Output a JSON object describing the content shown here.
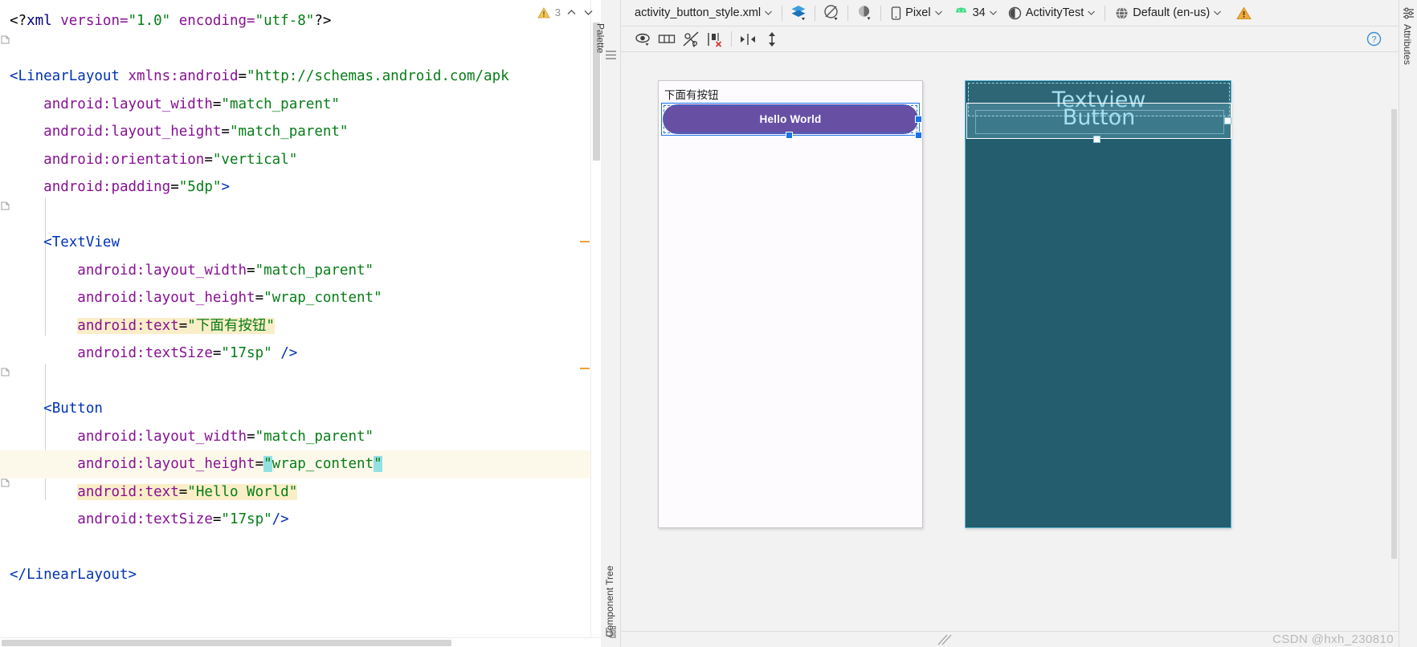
{
  "editor": {
    "inspection_count": "3",
    "lines": [
      {
        "id": "l1",
        "current": false,
        "tokens": [
          {
            "t": "<?",
            "c": "punct"
          },
          {
            "t": "xml",
            "c": "proc"
          },
          {
            "t": " version=",
            "c": "attr"
          },
          {
            "t": "\"1.0\"",
            "c": "val"
          },
          {
            "t": " encoding=",
            "c": "attr"
          },
          {
            "t": "\"utf-8\"",
            "c": "val"
          },
          {
            "t": "?>",
            "c": "punct"
          }
        ]
      },
      {
        "id": "l2",
        "current": false,
        "tokens": []
      },
      {
        "id": "l3",
        "current": false,
        "tokens": [
          {
            "t": "<LinearLayout",
            "c": "tag"
          },
          {
            "t": " xmlns:",
            "c": "ns"
          },
          {
            "t": "android",
            "c": "ns"
          },
          {
            "t": "=",
            "c": "punct"
          },
          {
            "t": "\"http://schemas.android.com/apk",
            "c": "val"
          }
        ]
      },
      {
        "id": "l4",
        "current": false,
        "tokens": [
          {
            "t": "    ",
            "c": "punct"
          },
          {
            "t": "android:layout_width",
            "c": "attr"
          },
          {
            "t": "=",
            "c": "punct"
          },
          {
            "t": "\"match_parent\"",
            "c": "val"
          }
        ]
      },
      {
        "id": "l5",
        "current": false,
        "tokens": [
          {
            "t": "    ",
            "c": "punct"
          },
          {
            "t": "android:layout_height",
            "c": "attr"
          },
          {
            "t": "=",
            "c": "punct"
          },
          {
            "t": "\"match_parent\"",
            "c": "val"
          }
        ]
      },
      {
        "id": "l6",
        "current": false,
        "tokens": [
          {
            "t": "    ",
            "c": "punct"
          },
          {
            "t": "android:orientation",
            "c": "attr"
          },
          {
            "t": "=",
            "c": "punct"
          },
          {
            "t": "\"vertical\"",
            "c": "val"
          }
        ]
      },
      {
        "id": "l7",
        "current": false,
        "tokens": [
          {
            "t": "    ",
            "c": "punct"
          },
          {
            "t": "android:padding",
            "c": "attr"
          },
          {
            "t": "=",
            "c": "punct"
          },
          {
            "t": "\"5dp\"",
            "c": "val"
          },
          {
            "t": ">",
            "c": "tag"
          }
        ]
      },
      {
        "id": "l8",
        "current": false,
        "tokens": []
      },
      {
        "id": "l9",
        "current": false,
        "tokens": [
          {
            "t": "    ",
            "c": "punct"
          },
          {
            "t": "<TextView",
            "c": "tag"
          }
        ]
      },
      {
        "id": "l10",
        "current": false,
        "tokens": [
          {
            "t": "        ",
            "c": "punct"
          },
          {
            "t": "android:layout_width",
            "c": "attr"
          },
          {
            "t": "=",
            "c": "punct"
          },
          {
            "t": "\"match_parent\"",
            "c": "val"
          }
        ]
      },
      {
        "id": "l11",
        "current": false,
        "tokens": [
          {
            "t": "        ",
            "c": "punct"
          },
          {
            "t": "android:layout_height",
            "c": "attr"
          },
          {
            "t": "=",
            "c": "punct"
          },
          {
            "t": "\"wrap_content\"",
            "c": "val"
          }
        ]
      },
      {
        "id": "l12",
        "current": false,
        "tokens": [
          {
            "t": "        ",
            "c": "punct"
          },
          {
            "t": "android:text",
            "c": "attr",
            "h": "y"
          },
          {
            "t": "=",
            "c": "punct",
            "h": "y"
          },
          {
            "t": "\"下面有按钮\"",
            "c": "val",
            "h": "y"
          }
        ]
      },
      {
        "id": "l13",
        "current": false,
        "tokens": [
          {
            "t": "        ",
            "c": "punct"
          },
          {
            "t": "android:textSize",
            "c": "attr"
          },
          {
            "t": "=",
            "c": "punct"
          },
          {
            "t": "\"17sp\"",
            "c": "val"
          },
          {
            "t": " ",
            "c": "punct"
          },
          {
            "t": "/>",
            "c": "tag"
          }
        ]
      },
      {
        "id": "l14",
        "current": false,
        "tokens": []
      },
      {
        "id": "l15",
        "current": false,
        "tokens": [
          {
            "t": "    ",
            "c": "punct"
          },
          {
            "t": "<Button",
            "c": "tag"
          }
        ]
      },
      {
        "id": "l16",
        "current": false,
        "tokens": [
          {
            "t": "        ",
            "c": "punct"
          },
          {
            "t": "android:layout_width",
            "c": "attr"
          },
          {
            "t": "=",
            "c": "punct"
          },
          {
            "t": "\"match_parent\"",
            "c": "val"
          }
        ]
      },
      {
        "id": "l17",
        "current": true,
        "tokens": [
          {
            "t": "        ",
            "c": "punct"
          },
          {
            "t": "android:layout_height",
            "c": "attr"
          },
          {
            "t": "=",
            "c": "punct"
          },
          {
            "t": "\"",
            "c": "val",
            "h": "c"
          },
          {
            "t": "wrap_content",
            "c": "val"
          },
          {
            "t": "\"",
            "c": "val",
            "h": "c"
          }
        ]
      },
      {
        "id": "l18",
        "current": false,
        "tokens": [
          {
            "t": "        ",
            "c": "punct"
          },
          {
            "t": "android:text",
            "c": "attr",
            "h": "y"
          },
          {
            "t": "=",
            "c": "punct",
            "h": "y"
          },
          {
            "t": "\"Hello World\"",
            "c": "val",
            "h": "y"
          }
        ]
      },
      {
        "id": "l19",
        "current": false,
        "tokens": [
          {
            "t": "        ",
            "c": "punct"
          },
          {
            "t": "android:textSize",
            "c": "attr"
          },
          {
            "t": "=",
            "c": "punct"
          },
          {
            "t": "\"17sp\"",
            "c": "val"
          },
          {
            "t": "/>",
            "c": "tag"
          }
        ]
      },
      {
        "id": "l20",
        "current": false,
        "tokens": []
      },
      {
        "id": "l21",
        "current": false,
        "tokens": [
          {
            "t": "</LinearLayout>",
            "c": "tag"
          }
        ]
      }
    ]
  },
  "strips": {
    "palette_label": "Palette",
    "component_tree_label": "Component Tree",
    "attributes_label": "Attributes"
  },
  "toolbar": {
    "file_name": "activity_button_style.xml",
    "design_mode_icon": "layers-icon",
    "orientation_icon": "rotate-device-icon",
    "theme_icon": "theme-contrast-icon",
    "device": "Pixel",
    "api_level": "34",
    "theme": "ActivityTest",
    "locale": "Default (en-us)",
    "warning_icon": "warning-triangle-icon",
    "settings_icon": "sliders-icon"
  },
  "view_toolbar": {
    "items": [
      {
        "name": "eye-visibility-icon",
        "label": "Show Design Surface"
      },
      {
        "name": "layout-columns-icon",
        "label": "Layout Variants"
      },
      {
        "name": "no-constraints-icon",
        "label": "Hide Constraints"
      },
      {
        "name": "clear-constraints-icon",
        "label": "Clear All Constraints"
      },
      {
        "name": "horizontal-align-icon",
        "label": "Align Horizontally"
      },
      {
        "name": "vertical-expand-icon",
        "label": "Expand Vertically"
      }
    ],
    "help_icon": "help-circle-icon"
  },
  "preview": {
    "textview_text": "下面有按钮",
    "button_text": "Hello World",
    "button_color": "#6750a4",
    "selection_color": "#1a73e8"
  },
  "blueprint": {
    "background": "#235d6e",
    "textview_label": "Textview",
    "button_label": "Button"
  },
  "footer": {
    "watermark": "CSDN @hxh_230810"
  }
}
